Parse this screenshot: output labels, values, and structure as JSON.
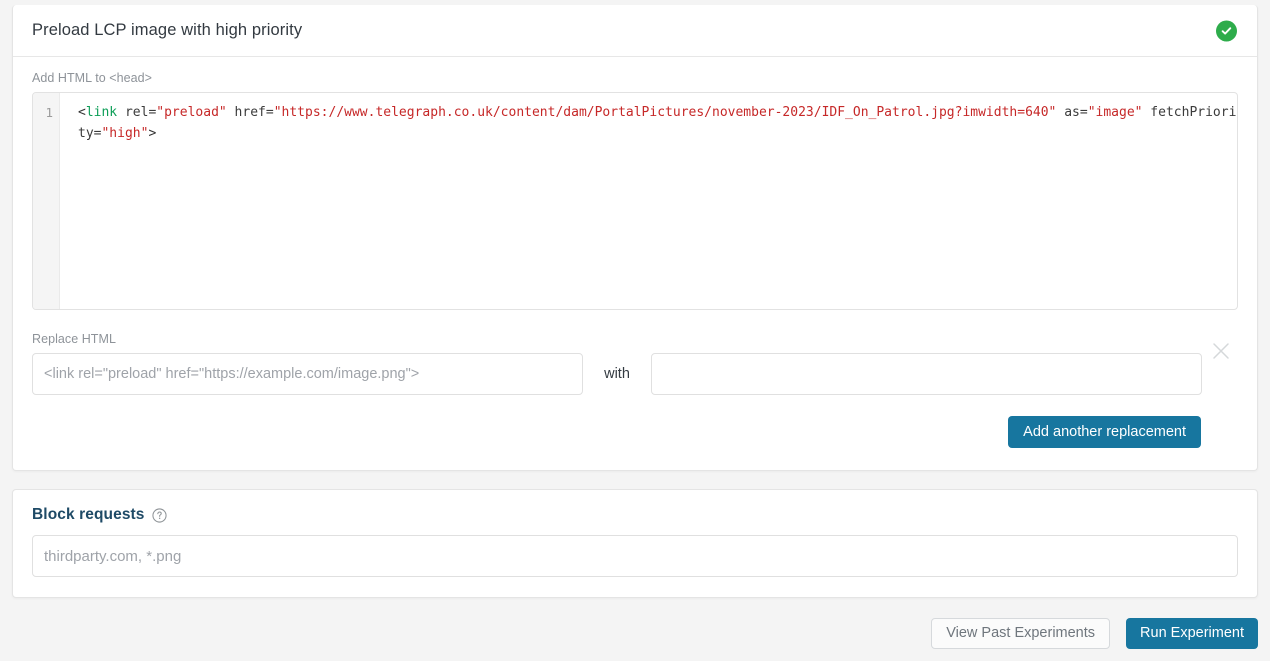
{
  "experiment_card": {
    "title": "Preload LCP image with high priority",
    "status_icon": "check-circle-icon",
    "status_color": "#2eac4b",
    "head_html": {
      "label": "Add HTML to <head>",
      "line_number": "1",
      "code_tokens": [
        {
          "t": "punct",
          "v": "<"
        },
        {
          "t": "tag",
          "v": "link"
        },
        {
          "t": "attr",
          "v": " rel="
        },
        {
          "t": "str",
          "v": "\"preload\""
        },
        {
          "t": "attr",
          "v": " href="
        },
        {
          "t": "str",
          "v": "\"https://www.telegraph.co.uk/content/dam/PortalPictures/november-2023/IDF_On_Patrol.jpg?imwidth=640\""
        },
        {
          "t": "attr",
          "v": " as="
        },
        {
          "t": "str",
          "v": "\"image\""
        },
        {
          "t": "attr",
          "v": " fetchPriority="
        },
        {
          "t": "str",
          "v": "\"high\""
        },
        {
          "t": "punct",
          "v": ">"
        }
      ],
      "code_plain": "<link rel=\"preload\" href=\"https://www.telegraph.co.uk/content/dam/PortalPictures/november-2023/IDF_On_Patrol.jpg?imwidth=640\" as=\"image\" fetchPriority=\"high\">"
    },
    "replace_html": {
      "label": "Replace HTML",
      "find_value": "",
      "find_placeholder": "<link rel=\"preload\" href=\"https://example.com/image.png\">",
      "with_label": "with",
      "with_value": "",
      "with_placeholder": "",
      "remove_icon": "close-x-icon",
      "add_button_label": "Add another replacement"
    }
  },
  "block_requests_card": {
    "title": "Block requests",
    "help_icon": "question-mark-circle-icon",
    "input_value": "",
    "input_placeholder": "thirdparty.com, *.png"
  },
  "footer": {
    "view_past_label": "View Past Experiments",
    "run_label": "Run Experiment"
  },
  "colors": {
    "accent_blue": "#17769f",
    "success_green": "#2eac4b",
    "heading_navy": "#1e4a66",
    "page_bg": "#f4f4f4"
  }
}
